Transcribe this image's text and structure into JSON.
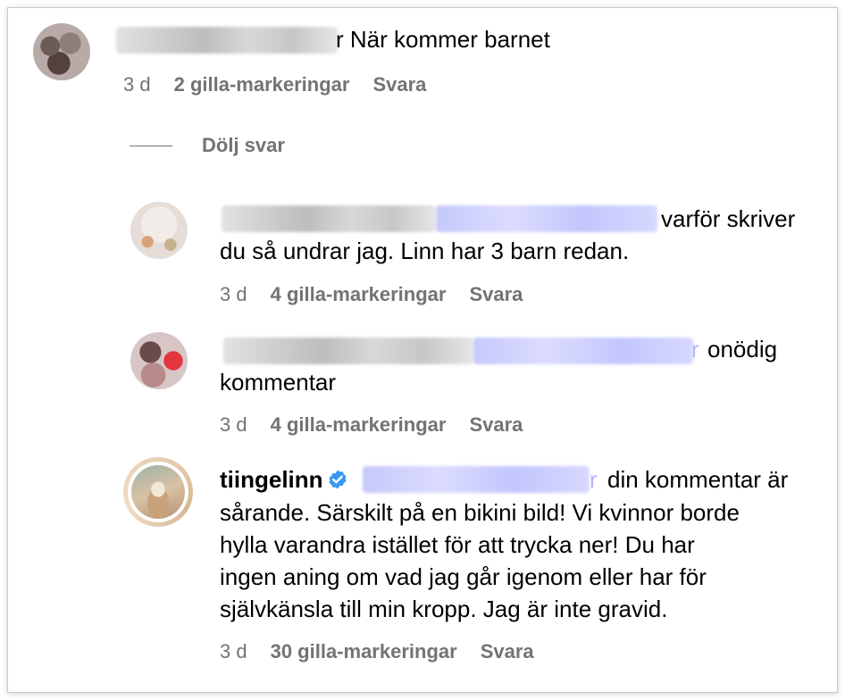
{
  "comments": [
    {
      "text": "r När kommer barnet",
      "age": "3 d",
      "likes": "2 gilla-markeringar",
      "reply": "Svara"
    },
    {
      "hide_replies": "Dölj svar"
    },
    {
      "line1": "varför skriver",
      "line2": "du så undrar jag. Linn har 3 barn redan.",
      "age": "3 d",
      "likes": "4 gilla-markeringar",
      "reply": "Svara"
    },
    {
      "line1_tail": "r",
      "line1": "onödig",
      "line2": "kommentar",
      "age": "3 d",
      "likes": "4 gilla-markeringar",
      "reply": "Svara"
    },
    {
      "username": "tiingelinn",
      "mention_tail": "r",
      "line1": "din kommentar är",
      "line2": "sårande. Särskilt på en bikini bild! Vi kvinnor borde",
      "line3": "hylla varandra istället för att trycka ner! Du har",
      "line4": "ingen aning om vad jag går igenom eller har för",
      "line5": "självkänsla till min kropp. Jag är inte gravid.",
      "age": "3 d",
      "likes": "30 gilla-markeringar",
      "reply": "Svara",
      "verified_icon": "verified-badge-icon",
      "verified_color": "#3897f0"
    }
  ]
}
